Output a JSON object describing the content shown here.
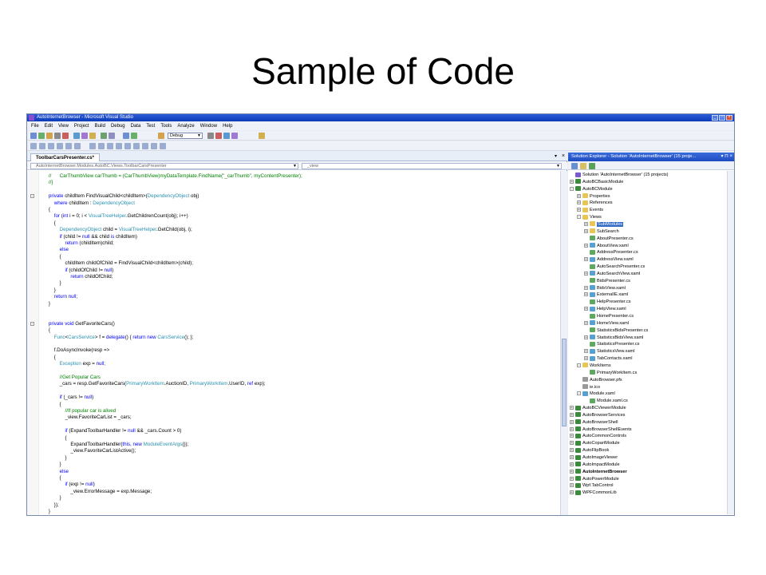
{
  "slide": {
    "title": "Sample of Code"
  },
  "window": {
    "title": "AutoInternetBrowser - Microsoft Visual Studio"
  },
  "menu": [
    "File",
    "Edit",
    "View",
    "Project",
    "Build",
    "Debug",
    "Data",
    "Test",
    "Tools",
    "Analyze",
    "Window",
    "Help"
  ],
  "toolbar": {
    "config": "Debug"
  },
  "editor": {
    "tab": "ToolbarCarsPresenter.cs*",
    "nav_left": "AutoInternetBrowser.Modules.AutoBC.Views.ToolbarCarsPresenter",
    "nav_right": "_view",
    "lines": [
      "    //      CarThumbView carThumb = (CarThumbView)myDataTemplate.FindName(\"_carThumb\", myContentPresenter);",
      "    //}",
      "",
      "    private childItem FindVisualChild<childItem>(DependencyObject obj)",
      "        where childItem : DependencyObject",
      "    {",
      "        for (int i = 0; i < VisualTreeHelper.GetChildrenCount(obj); i++)",
      "        {",
      "            DependencyObject child = VisualTreeHelper.GetChild(obj, i);",
      "            if (child != null && child is childItem)",
      "                return (childItem)child;",
      "            else",
      "            {",
      "                childItem childOfChild = FindVisualChild<childItem>(child);",
      "                if (childOfChild != null)",
      "                    return childOfChild;",
      "            }",
      "        }",
      "        return null;",
      "    }",
      "",
      "",
      "    private void GetFavoriteCars()",
      "    {",
      "        Func<CarsService> f = delegate() { return new CarsService(); };",
      "",
      "        f.DoAsyncInvoke(resp =>",
      "        {",
      "            Exception exp = null;",
      "",
      "            //Get Popular Cars",
      "            _cars = resp.GetFavoriteCars(PrimaryWorkItem.AuctionID, PrimaryWorkItem.UserID, ref exp);",
      "",
      "            if (_cars != null)",
      "            {",
      "                //If popular car is alived",
      "                _view.FavoriteCarList = _cars;",
      "",
      "                if (ExpandToolbarHandler != null && _cars.Count > 0)",
      "                {",
      "                    ExpandToolbarHandler(this, new ModuleEventArgs());",
      "                    _view.FavoriteCarListActive();",
      "                }",
      "            }",
      "            else",
      "            {",
      "                if (exp != null)",
      "                    _view.ErrorMessage = exp.Message;",
      "            }",
      "        });",
      "    }"
    ]
  },
  "solution_explorer": {
    "title": "Solution Explorer - Solution 'AutoInternetBrowser' (15 proje...",
    "items": [
      {
        "label": "Solution 'AutoInternetBrowser' (15 projects)",
        "depth": 0,
        "icon": "solution-icon",
        "exp": ""
      },
      {
        "label": "AutoBCBasicModule",
        "depth": 0,
        "icon": "project-icon",
        "exp": "+"
      },
      {
        "label": "AutoBCModule",
        "depth": 0,
        "icon": "project-icon",
        "exp": "-"
      },
      {
        "label": "Properties",
        "depth": 1,
        "icon": "folder-icon",
        "exp": "+"
      },
      {
        "label": "References",
        "depth": 1,
        "icon": "folder-icon",
        "exp": "+"
      },
      {
        "label": "Events",
        "depth": 1,
        "icon": "folder-icon",
        "exp": "+"
      },
      {
        "label": "Views",
        "depth": 1,
        "icon": "folder-icon",
        "exp": "-"
      },
      {
        "label": "SubModules",
        "depth": 2,
        "icon": "folder-icon",
        "exp": "+",
        "selected": true
      },
      {
        "label": "SubSearch",
        "depth": 2,
        "icon": "folder-icon",
        "exp": "+"
      },
      {
        "label": "AboutPresenter.cs",
        "depth": 2,
        "icon": "cs-file-icon",
        "exp": ""
      },
      {
        "label": "AboutView.xaml",
        "depth": 2,
        "icon": "xaml-file-icon",
        "exp": "+"
      },
      {
        "label": "AddressPresenter.cs",
        "depth": 2,
        "icon": "cs-file-icon",
        "exp": ""
      },
      {
        "label": "AddressView.xaml",
        "depth": 2,
        "icon": "xaml-file-icon",
        "exp": "+"
      },
      {
        "label": "AutoSearchPresenter.cs",
        "depth": 2,
        "icon": "cs-file-icon",
        "exp": ""
      },
      {
        "label": "AutoSearchView.xaml",
        "depth": 2,
        "icon": "xaml-file-icon",
        "exp": "+"
      },
      {
        "label": "BidsPresenter.cs",
        "depth": 2,
        "icon": "cs-file-icon",
        "exp": ""
      },
      {
        "label": "BidsView.xaml",
        "depth": 2,
        "icon": "xaml-file-icon",
        "exp": "+"
      },
      {
        "label": "ExternalIE.xaml",
        "depth": 2,
        "icon": "xaml-file-icon",
        "exp": "+"
      },
      {
        "label": "HelpPresenter.cs",
        "depth": 2,
        "icon": "cs-file-icon",
        "exp": ""
      },
      {
        "label": "HelpView.xaml",
        "depth": 2,
        "icon": "xaml-file-icon",
        "exp": "+"
      },
      {
        "label": "HomePresenter.cs",
        "depth": 2,
        "icon": "cs-file-icon",
        "exp": ""
      },
      {
        "label": "HomeView.xaml",
        "depth": 2,
        "icon": "xaml-file-icon",
        "exp": "+"
      },
      {
        "label": "StatisticsBidsPresenter.cs",
        "depth": 2,
        "icon": "cs-file-icon",
        "exp": ""
      },
      {
        "label": "StatisticsBidsView.xaml",
        "depth": 2,
        "icon": "xaml-file-icon",
        "exp": "+"
      },
      {
        "label": "StatisticsPresenter.cs",
        "depth": 2,
        "icon": "cs-file-icon",
        "exp": ""
      },
      {
        "label": "StatisticsView.xaml",
        "depth": 2,
        "icon": "xaml-file-icon",
        "exp": "+"
      },
      {
        "label": "TabContacts.xaml",
        "depth": 2,
        "icon": "xaml-file-icon",
        "exp": "+"
      },
      {
        "label": "WorkItems",
        "depth": 1,
        "icon": "folder-icon",
        "exp": "-"
      },
      {
        "label": "PrimaryWorkItem.cs",
        "depth": 2,
        "icon": "cs-file-icon",
        "exp": ""
      },
      {
        "label": "AutoBrowser.pfx",
        "depth": 1,
        "icon": "file-icon",
        "exp": ""
      },
      {
        "label": "ie.ico",
        "depth": 1,
        "icon": "file-icon",
        "exp": ""
      },
      {
        "label": "Module.xaml",
        "depth": 1,
        "icon": "xaml-file-icon",
        "exp": "-"
      },
      {
        "label": "Module.xaml.cs",
        "depth": 2,
        "icon": "cs-file-icon",
        "exp": ""
      },
      {
        "label": "AutoBCViewerModule",
        "depth": 0,
        "icon": "project-icon",
        "exp": "+"
      },
      {
        "label": "AutoBrowserServices",
        "depth": 0,
        "icon": "project-icon",
        "exp": "+"
      },
      {
        "label": "AutoBrowserShell",
        "depth": 0,
        "icon": "project-icon",
        "exp": "+"
      },
      {
        "label": "AutoBrowserShellEvents",
        "depth": 0,
        "icon": "project-icon",
        "exp": "+"
      },
      {
        "label": "AutoCommonControls",
        "depth": 0,
        "icon": "project-icon",
        "exp": "+"
      },
      {
        "label": "AutoCopartModule",
        "depth": 0,
        "icon": "project-icon",
        "exp": "+"
      },
      {
        "label": "AutoFlipBook",
        "depth": 0,
        "icon": "project-icon",
        "exp": "+"
      },
      {
        "label": "AutoImageViewer",
        "depth": 0,
        "icon": "project-icon",
        "exp": "+"
      },
      {
        "label": "AutoImpactModule",
        "depth": 0,
        "icon": "project-icon",
        "exp": "+"
      },
      {
        "label": "AutoInternetBrowser",
        "depth": 0,
        "icon": "project-icon",
        "exp": "+",
        "bold": true
      },
      {
        "label": "AutoPowerModule",
        "depth": 0,
        "icon": "project-icon",
        "exp": "+"
      },
      {
        "label": "Wpf.TabControl",
        "depth": 0,
        "icon": "project-icon",
        "exp": "+"
      },
      {
        "label": "WPFCommonLib",
        "depth": 0,
        "icon": "project-icon",
        "exp": "+"
      }
    ]
  },
  "colors": {
    "keyword": "#0000ff",
    "type": "#2b91af",
    "comment": "#008000",
    "selection": "#316ac5",
    "titlebar": "#1d4cc0"
  }
}
